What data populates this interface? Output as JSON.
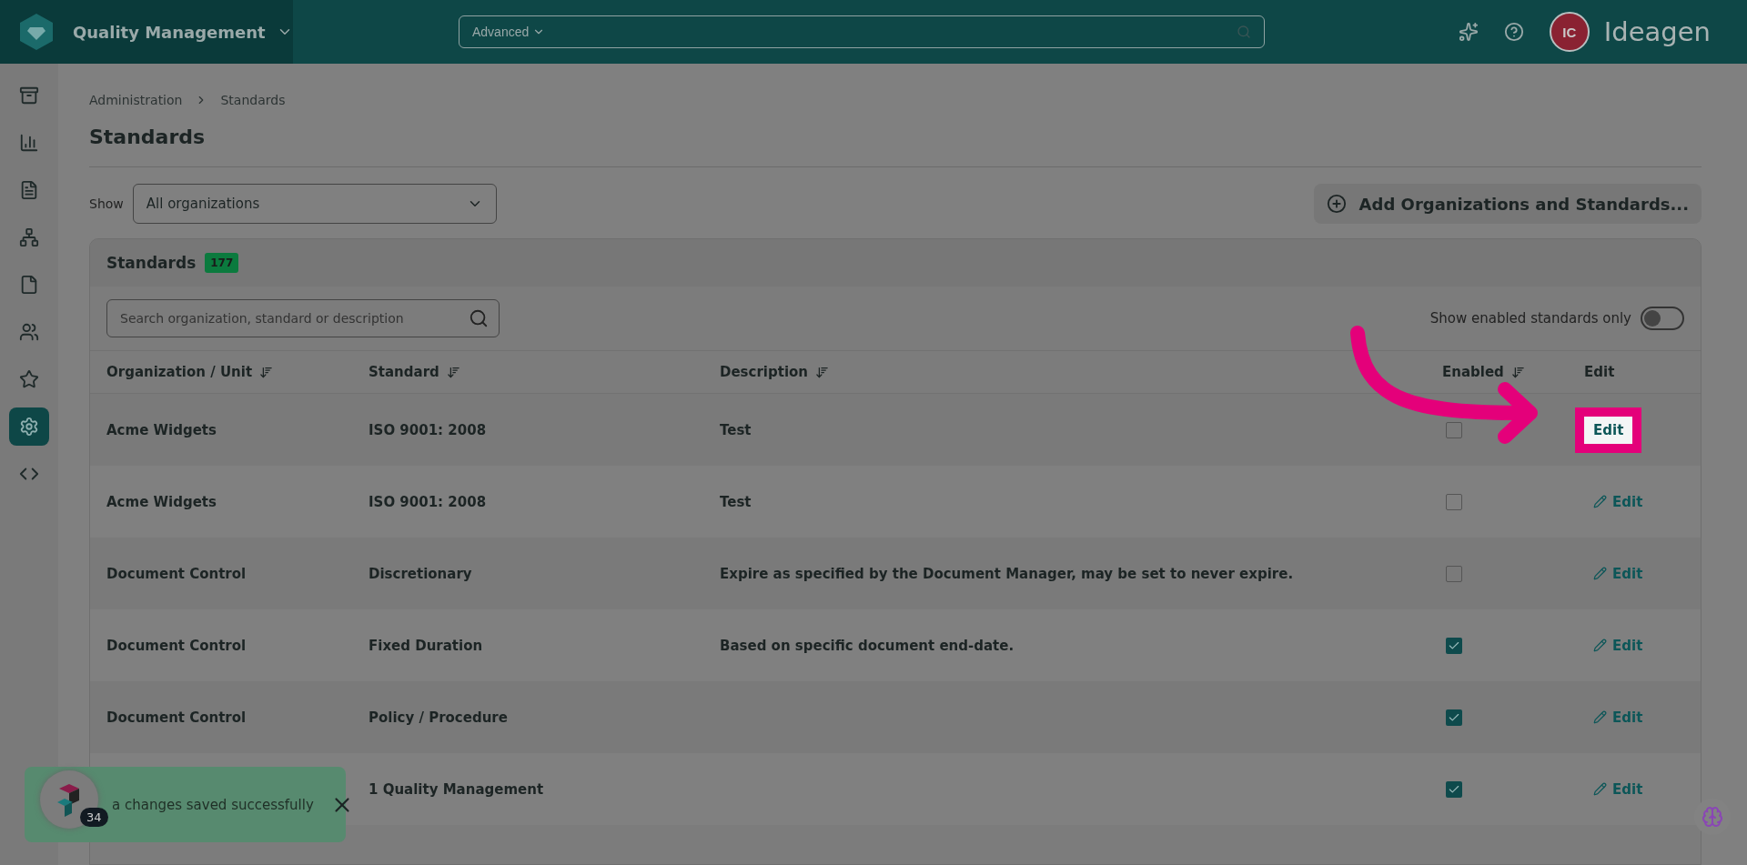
{
  "top_bar": {
    "app_title": "Quality Management",
    "search_scope": "Advanced",
    "avatar": "IC",
    "brand": "Ideagen"
  },
  "sidebar": {
    "items": [
      {
        "kind": "archive",
        "selected": false
      },
      {
        "kind": "chart",
        "selected": false
      },
      {
        "kind": "document",
        "selected": false
      },
      {
        "kind": "hierarchy",
        "selected": false
      },
      {
        "kind": "file",
        "selected": false
      },
      {
        "kind": "team",
        "selected": false
      },
      {
        "kind": "star",
        "selected": false
      },
      {
        "kind": "settings",
        "selected": true
      },
      {
        "kind": "code",
        "selected": false
      }
    ]
  },
  "breadcrumb": [
    "Administration",
    "Standards"
  ],
  "title": "Standards",
  "filter": {
    "label": "Show",
    "value": "All organizations"
  },
  "add_button": "Add Organizations and Standards...",
  "card": {
    "title": "Standards",
    "count": "177",
    "search": {
      "placeholder": "Search organization, standard or description"
    },
    "toggle": {
      "label": "Show enabled standards only",
      "on": false
    }
  },
  "columns": [
    {
      "label": "Organization / Unit",
      "sortable": true
    },
    {
      "label": "Standard",
      "sortable": true
    },
    {
      "label": "Description",
      "sortable": true
    },
    {
      "label": "Enabled",
      "sortable": true
    },
    {
      "label": "Edit",
      "sortable": false
    }
  ],
  "rows": [
    {
      "organization": "Acme Widgets",
      "standard": "ISO 9001: 2008",
      "description": "Test",
      "enabled": false,
      "edit": "Edit",
      "highlighted": true
    },
    {
      "organization": "Acme Widgets",
      "standard": "ISO 9001: 2008",
      "description": "Test",
      "enabled": false,
      "edit": "Edit",
      "highlighted": false
    },
    {
      "organization": "Document Control",
      "standard": "Discretionary",
      "description": "Expire as specified by the Document Manager, may be set to never expire.",
      "enabled": false,
      "edit": "Edit",
      "highlighted": false
    },
    {
      "organization": "Document Control",
      "standard": "Fixed Duration",
      "description": "Based on specific document end-date.",
      "enabled": true,
      "edit": "Edit",
      "highlighted": false
    },
    {
      "organization": "Document Control",
      "standard": "Policy / Procedure",
      "description": "",
      "enabled": true,
      "edit": "Edit",
      "highlighted": false
    },
    {
      "organization": "",
      "standard": "1 Quality Management",
      "description": "",
      "enabled": true,
      "edit": "Edit",
      "highlighted": false
    }
  ],
  "toast": {
    "message": "a changes saved successfully"
  },
  "widget": {
    "badge": "34"
  }
}
